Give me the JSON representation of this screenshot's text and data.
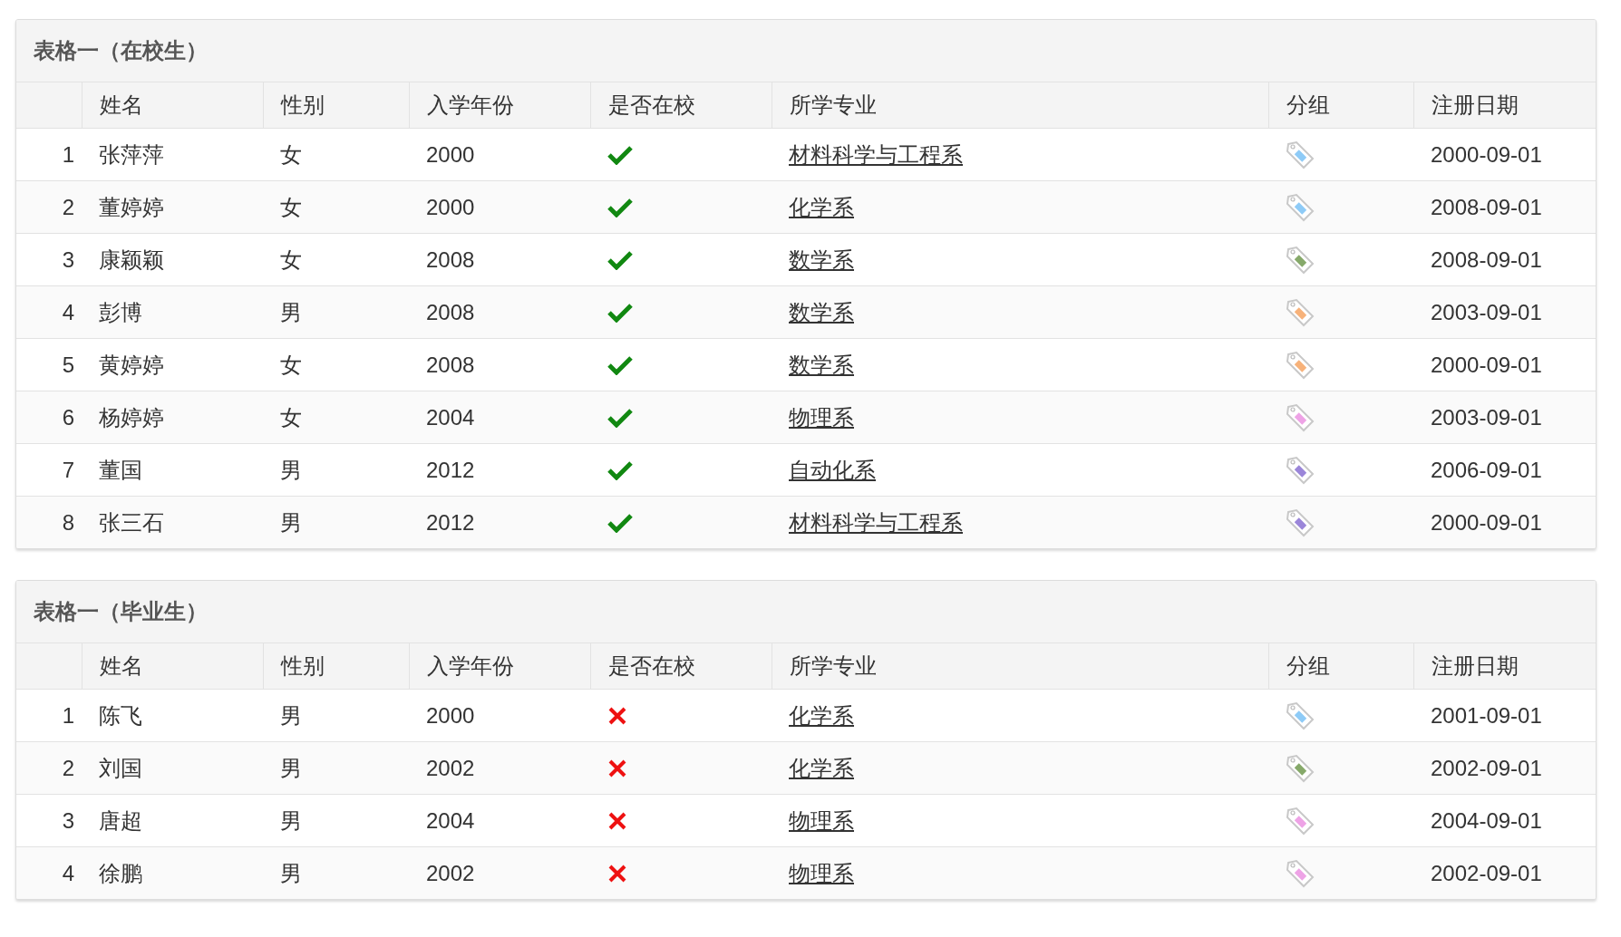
{
  "tables": [
    {
      "title": "表格一（在校生）",
      "columns": [
        "姓名",
        "性别",
        "入学年份",
        "是否在校",
        "所学专业",
        "分组",
        "注册日期"
      ],
      "rows": [
        {
          "index": "1",
          "name": "张萍萍",
          "gender": "女",
          "year": "2000",
          "enrolled": true,
          "major": "材料科学与工程系",
          "color": "#8ecbf7",
          "date": "2000-09-01"
        },
        {
          "index": "2",
          "name": "董婷婷",
          "gender": "女",
          "year": "2000",
          "enrolled": true,
          "major": "化学系",
          "color": "#8ecbf7",
          "date": "2008-09-01"
        },
        {
          "index": "3",
          "name": "康颖颖",
          "gender": "女",
          "year": "2008",
          "enrolled": true,
          "major": "数学系",
          "color": "#86a96a",
          "date": "2008-09-01"
        },
        {
          "index": "4",
          "name": "彭博",
          "gender": "男",
          "year": "2008",
          "enrolled": true,
          "major": "数学系",
          "color": "#f7b27a",
          "date": "2003-09-01"
        },
        {
          "index": "5",
          "name": "黄婷婷",
          "gender": "女",
          "year": "2008",
          "enrolled": true,
          "major": "数学系",
          "color": "#f7b27a",
          "date": "2000-09-01"
        },
        {
          "index": "6",
          "name": "杨婷婷",
          "gender": "女",
          "year": "2004",
          "enrolled": true,
          "major": "物理系",
          "color": "#eea3e6",
          "date": "2003-09-01"
        },
        {
          "index": "7",
          "name": "董国",
          "gender": "男",
          "year": "2012",
          "enrolled": true,
          "major": "自动化系",
          "color": "#9b86d9",
          "date": "2006-09-01"
        },
        {
          "index": "8",
          "name": "张三石",
          "gender": "男",
          "year": "2012",
          "enrolled": true,
          "major": "材料科学与工程系",
          "color": "#9b86d9",
          "date": "2000-09-01"
        }
      ]
    },
    {
      "title": "表格一（毕业生）",
      "columns": [
        "姓名",
        "性别",
        "入学年份",
        "是否在校",
        "所学专业",
        "分组",
        "注册日期"
      ],
      "rows": [
        {
          "index": "1",
          "name": "陈飞",
          "gender": "男",
          "year": "2000",
          "enrolled": false,
          "major": "化学系",
          "color": "#8ecbf7",
          "date": "2001-09-01"
        },
        {
          "index": "2",
          "name": "刘国",
          "gender": "男",
          "year": "2002",
          "enrolled": false,
          "major": "化学系",
          "color": "#86a96a",
          "date": "2002-09-01"
        },
        {
          "index": "3",
          "name": "唐超",
          "gender": "男",
          "year": "2004",
          "enrolled": false,
          "major": "物理系",
          "color": "#eea3e6",
          "date": "2004-09-01"
        },
        {
          "index": "4",
          "name": "徐鹏",
          "gender": "男",
          "year": "2002",
          "enrolled": false,
          "major": "物理系",
          "color": "#eea3e6",
          "date": "2002-09-01"
        }
      ]
    }
  ]
}
